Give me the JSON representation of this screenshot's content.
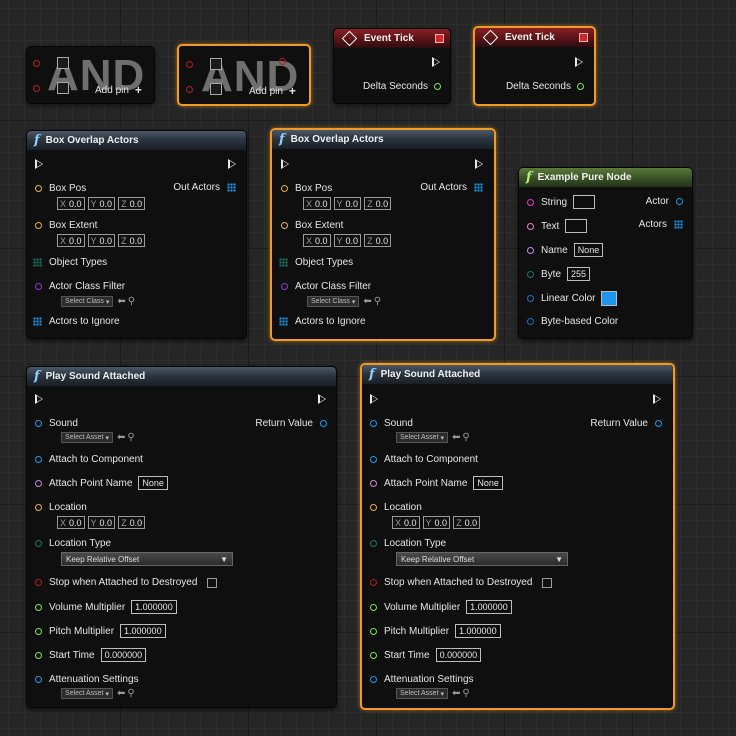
{
  "and_nodes": [
    {
      "title": "AND",
      "add_pin": "Add pin"
    },
    {
      "title": "AND",
      "add_pin": "Add pin"
    }
  ],
  "event_nodes": [
    {
      "title": "Event Tick",
      "delta": "Delta Seconds"
    },
    {
      "title": "Event Tick",
      "delta": "Delta Seconds"
    }
  ],
  "box_overlap": {
    "title": "Box Overlap Actors",
    "box_pos": "Box Pos",
    "box_extent": "Box Extent",
    "out_actors": "Out Actors",
    "x": "X",
    "y": "Y",
    "z": "Z",
    "v": "0.0",
    "object_types": "Object Types",
    "actor_class_filter": "Actor Class Filter",
    "select_class": "Select Class",
    "actors_to_ignore": "Actors to Ignore"
  },
  "pure_node": {
    "title": "Example Pure Node",
    "string": "String",
    "text": "Text",
    "name": "Name",
    "name_val": "None",
    "byte": "Byte",
    "byte_val": "255",
    "linear_color": "Linear Color",
    "byte_color": "Byte-based Color",
    "actor": "Actor",
    "actors": "Actors"
  },
  "play_sound": {
    "title": "Play Sound Attached",
    "sound": "Sound",
    "select_asset": "Select Asset",
    "return_value": "Return Value",
    "attach_component": "Attach to Component",
    "attach_point": "Attach Point Name",
    "attach_val": "None",
    "location": "Location",
    "x": "X",
    "y": "Y",
    "z": "Z",
    "v": "0.0",
    "location_type": "Location Type",
    "location_type_val": "Keep Relative Offset",
    "stop_destroyed": "Stop when Attached to Destroyed",
    "volume": "Volume Multiplier",
    "volume_val": "1.000000",
    "pitch": "Pitch Multiplier",
    "pitch_val": "1.000000",
    "start_time": "Start Time",
    "start_val": "0.000000",
    "attenuation": "Attenuation Settings"
  },
  "colors": {
    "exec": "#e8e8e8",
    "bool": "#b32020",
    "float": "#7ee65a",
    "vector": "#e8b03c",
    "object": "#1e9cf0",
    "class": "#8a3fe0",
    "name": "#c78ae8",
    "string": "#e23cbc",
    "text": "#e086c6",
    "byte": "#1a7a68",
    "struct": "#1b74c8",
    "selection": "#f29a26"
  }
}
